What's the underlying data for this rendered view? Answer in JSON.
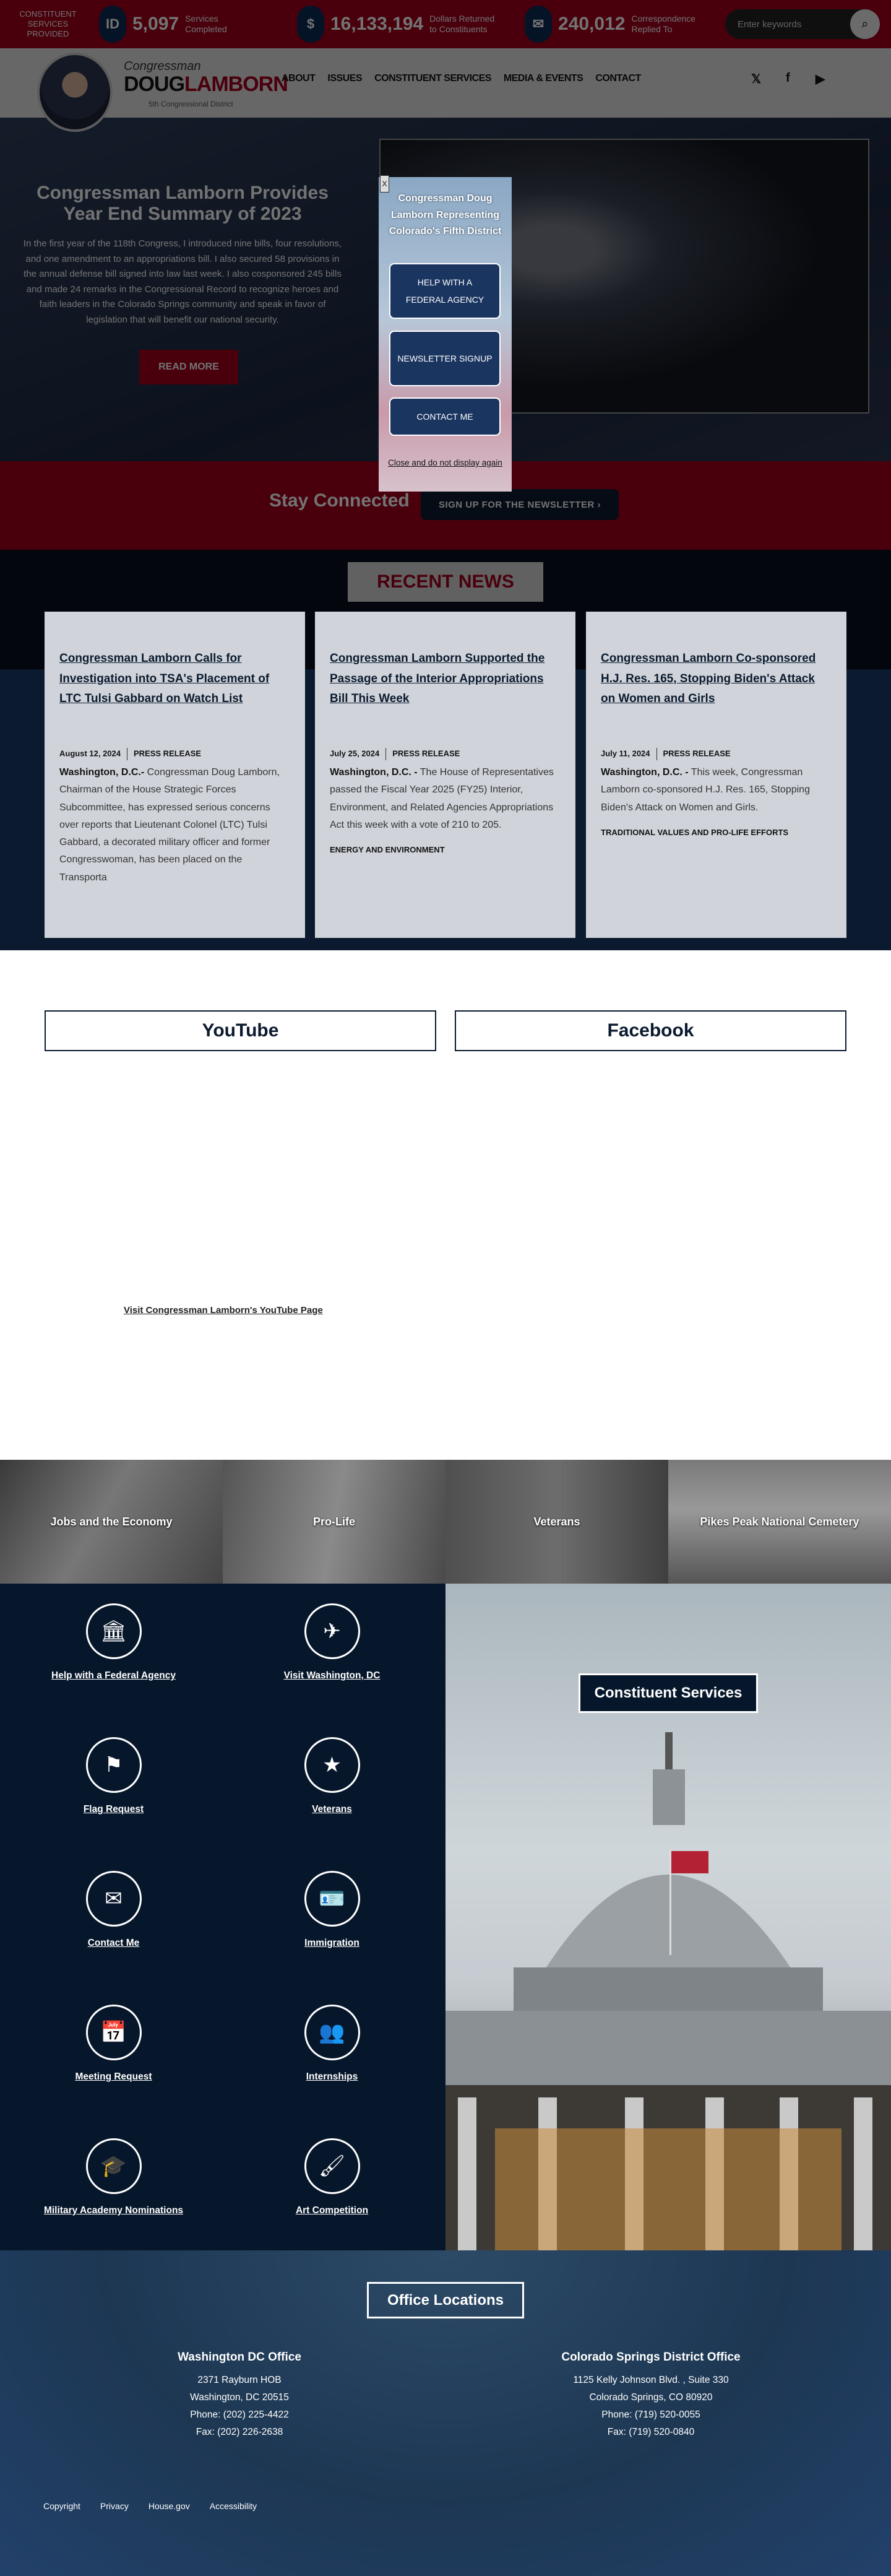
{
  "topbar": {
    "services_label": "Constituent Services Provided",
    "stats": [
      {
        "icon": "id-card-icon",
        "glyph": "ID",
        "value": "5,097",
        "label": "Services Completed"
      },
      {
        "icon": "dollar-icon",
        "glyph": "$",
        "value": "16,133,194",
        "label": "Dollars Returned to Constituents"
      },
      {
        "icon": "envelope-icon",
        "glyph": "✉",
        "value": "240,012",
        "label": "Correspondence Replied To"
      }
    ],
    "search_placeholder": "Enter keywords"
  },
  "header": {
    "logo": {
      "line1": "Congressman",
      "first": "DOUG",
      "last": "LAMBORN",
      "district": "5th Congressional District"
    },
    "nav": [
      "ABOUT",
      "ISSUES",
      "CONSTITUENT SERVICES",
      "MEDIA & EVENTS",
      "CONTACT"
    ],
    "social": [
      "x-icon",
      "facebook-icon",
      "youtube-icon"
    ]
  },
  "hero": {
    "title": "Congressman Lamborn Provides Year End Summary of 2023",
    "text": "In the first year of the 118th Congress, I introduced nine bills, four resolutions, and one amendment to an appropriations bill. I also secured 58 provisions in the annual defense bill signed into law last week. I also cosponsored 245 bills and made 24 remarks in the Congressional Record to recognize heroes and faith leaders in the Colorado Springs community and speak in favor of legislation that will benefit our national security.",
    "button": "READ MORE"
  },
  "stay": {
    "title": "Stay Connected",
    "button": "SIGN UP FOR THE NEWSLETTER ›"
  },
  "popup": {
    "close": "X",
    "title": "Congressman Doug Lamborn Representing Colorado's Fifth District",
    "buttons": [
      "HELP WITH A FEDERAL AGENCY",
      "NEWSLETTER SIGNUP",
      "CONTACT ME"
    ],
    "dismiss": "Close and do not display again"
  },
  "news": {
    "heading": "RECENT NEWS",
    "items": [
      {
        "title": "Congressman Lamborn Calls for Investigation into TSA's Placement of LTC Tulsi Gabbard on Watch List",
        "date": "August 12, 2024",
        "type": "PRESS RELEASE",
        "dateline": "Washington, D.C.-",
        "body": " Congressman Doug Lamborn, Chairman of the House Strategic Forces Subcommittee, has expressed serious concerns over reports that Lieutenant Colonel (LTC) Tulsi Gabbard, a decorated military officer and former Congresswoman, has been placed on the Transporta",
        "tag": ""
      },
      {
        "title": "Congressman Lamborn Supported the Passage of the Interior Appropriations Bill This Week",
        "date": "July 25, 2024",
        "type": "PRESS RELEASE",
        "dateline": "Washington, D.C. -",
        "body": " The House of Representatives passed the Fiscal Year 2025 (FY25) Interior, Environment, and Related Agencies Appropriations Act this week with a vote of 210 to 205.",
        "tag": "ENERGY AND ENVIRONMENT"
      },
      {
        "title": "Congressman Lamborn Co-sponsored H.J. Res. 165, Stopping Biden's Attack on Women and Girls",
        "date": "July 11, 2024",
        "type": "PRESS RELEASE",
        "dateline": "Washington, D.C. -",
        "body": " This week, Congressman Lamborn co-sponsored H.J. Res. 165, Stopping Biden's Attack on Women and Girls.",
        "tag": "TRADITIONAL VALUES AND PRO-LIFE EFFORTS"
      }
    ]
  },
  "social_section": {
    "youtube": "YouTube",
    "facebook": "Facebook",
    "youtube_link": "Visit Congressman Lamborn's YouTube Page"
  },
  "tiles": [
    "Jobs and the Economy",
    "Pro-Life",
    "Veterans",
    "Pikes Peak National Cemetery"
  ],
  "services": {
    "heading": "Constituent Services",
    "items": [
      {
        "label": "Help with a Federal Agency",
        "icon": "building-columns-icon",
        "glyph": "🏛"
      },
      {
        "label": "Visit Washington, DC",
        "icon": "plane-icon",
        "glyph": "✈"
      },
      {
        "label": "Flag Request",
        "icon": "flag-icon",
        "glyph": "⚑"
      },
      {
        "label": "Veterans",
        "icon": "star-icon",
        "glyph": "★"
      },
      {
        "label": "Contact Me",
        "icon": "envelope-icon",
        "glyph": "✉"
      },
      {
        "label": "Immigration",
        "icon": "id-card-icon",
        "glyph": "🪪"
      },
      {
        "label": "Meeting Request",
        "icon": "calendar-icon",
        "glyph": "📅"
      },
      {
        "label": "Internships",
        "icon": "users-icon",
        "glyph": "👥"
      },
      {
        "label": "Military Academy Nominations",
        "icon": "graduation-cap-icon",
        "glyph": "🎓"
      },
      {
        "label": "Art Competition",
        "icon": "paintbrush-icon",
        "glyph": "🖌"
      }
    ]
  },
  "footer": {
    "heading": "Office Locations",
    "offices": [
      {
        "name": "Washington DC Office",
        "lines": [
          "2371 Rayburn HOB",
          "Washington, DC 20515",
          "Phone: (202) 225-4422",
          "Fax: (202) 226-2638"
        ]
      },
      {
        "name": "Colorado Springs District Office",
        "lines": [
          "1125 Kelly Johnson Blvd. , Suite 330",
          "Colorado Springs, CO 80920",
          "Phone: (719) 520-0055",
          "Fax: (719) 520-0840"
        ]
      }
    ],
    "links": [
      "Copyright",
      "Privacy",
      "House.gov",
      "Accessibility"
    ]
  },
  "colors": {
    "brand_red": "#a3001b",
    "navy": "#0b1a2f",
    "card": "#d0d4da"
  }
}
